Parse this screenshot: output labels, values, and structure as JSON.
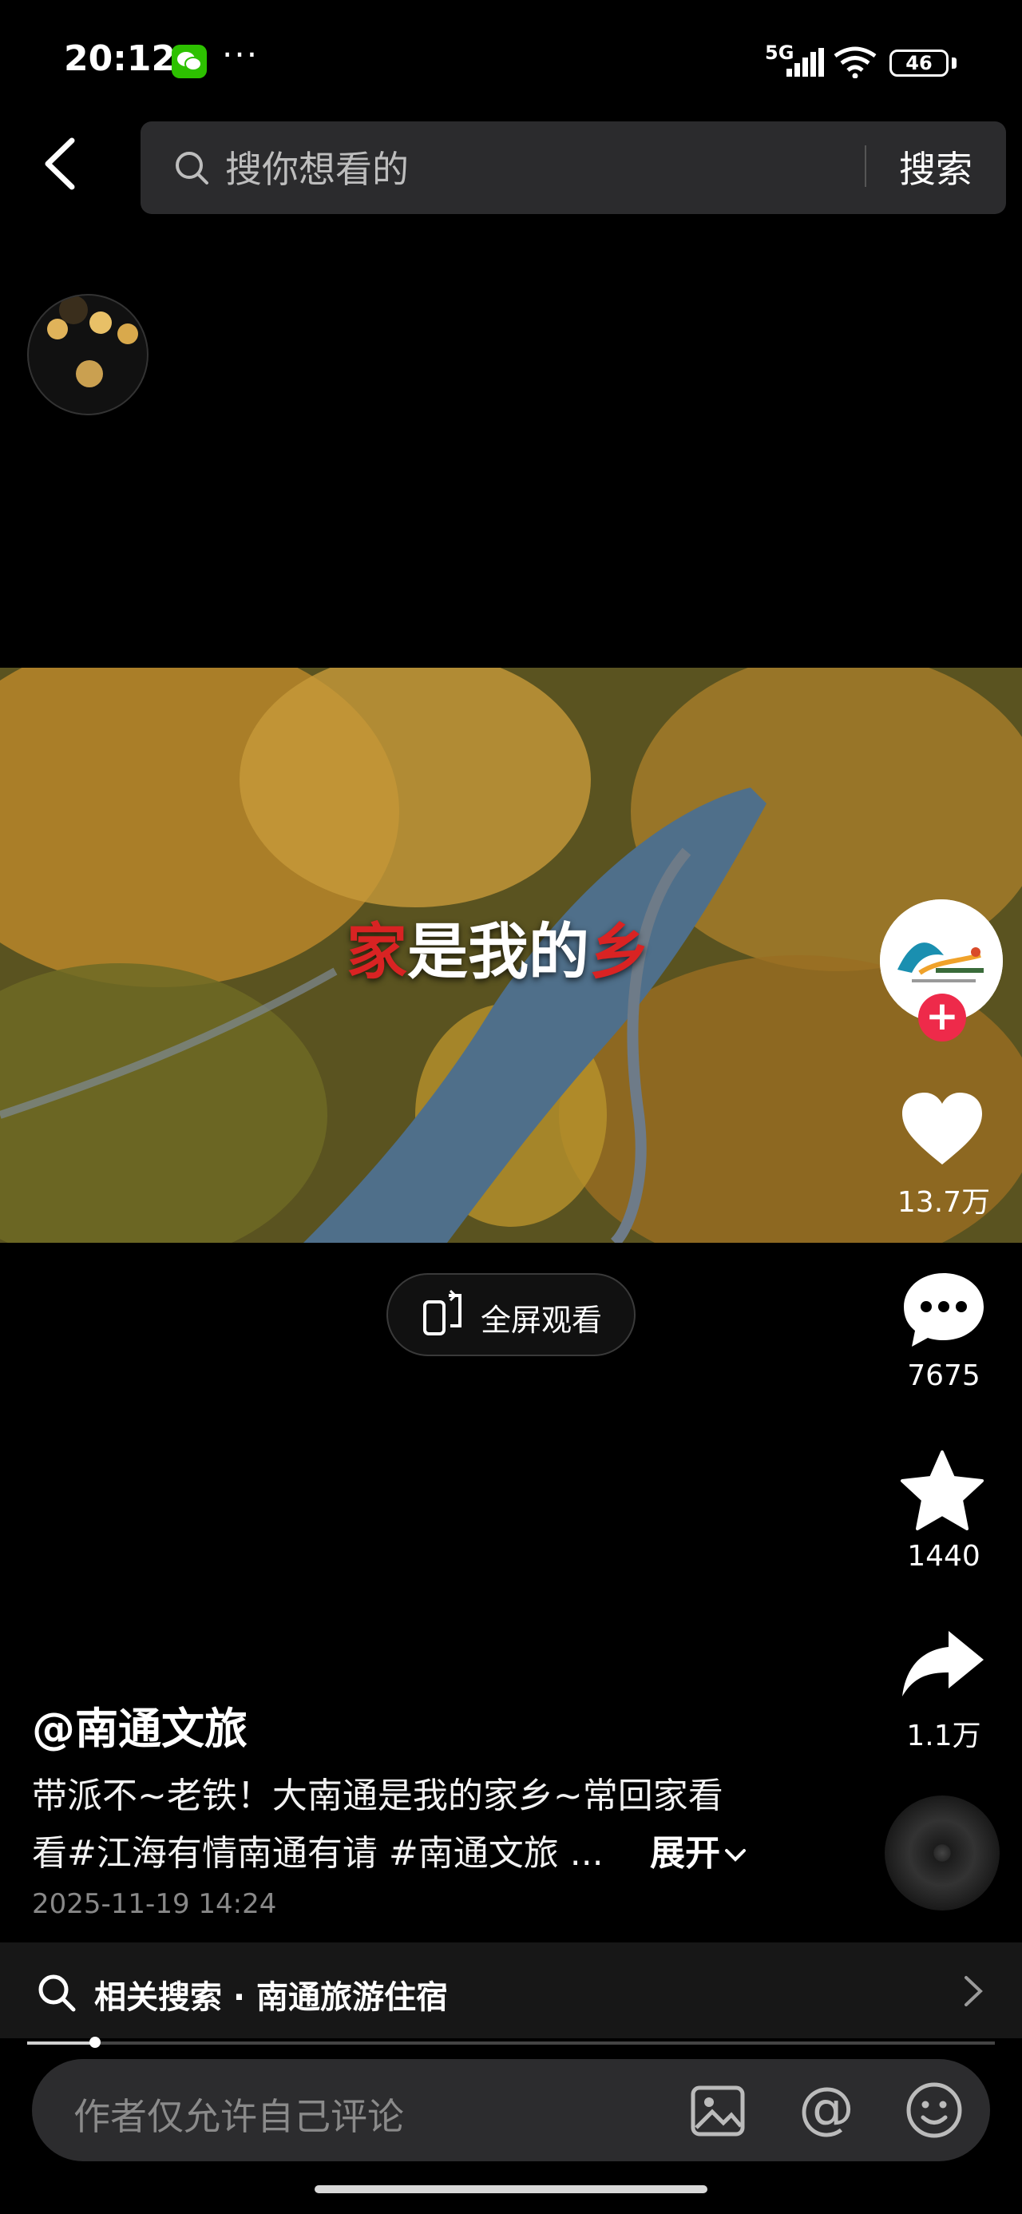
{
  "status_bar": {
    "time": "20:12",
    "dots": "···",
    "network": "5G",
    "battery": "46"
  },
  "search": {
    "placeholder": "搜你想看的",
    "button": "搜索"
  },
  "video": {
    "overlay_prefix": "家",
    "overlay_middle": "是我的",
    "overlay_suffix": "乡"
  },
  "fullscreen": {
    "label": "全屏观看"
  },
  "actions": {
    "likes": "13.7万",
    "comments": "7675",
    "favorites": "1440",
    "shares": "1.1万"
  },
  "post": {
    "author": "@南通文旅",
    "desc_line1": "带派不~老铁！大南通是我的家乡~常回家看",
    "desc_line2": "看#江海有情南通有请 #南通文旅 ...",
    "expand": "展开",
    "time": "2025-11-19 14:24"
  },
  "related": {
    "text": "相关搜索 · 南通旅游住宿"
  },
  "progress": {
    "fraction": 0.07
  },
  "comment": {
    "placeholder": "作者仅允许自己评论"
  },
  "colors": {
    "accent": "#ee2a4a",
    "wechat": "#2dc100"
  }
}
